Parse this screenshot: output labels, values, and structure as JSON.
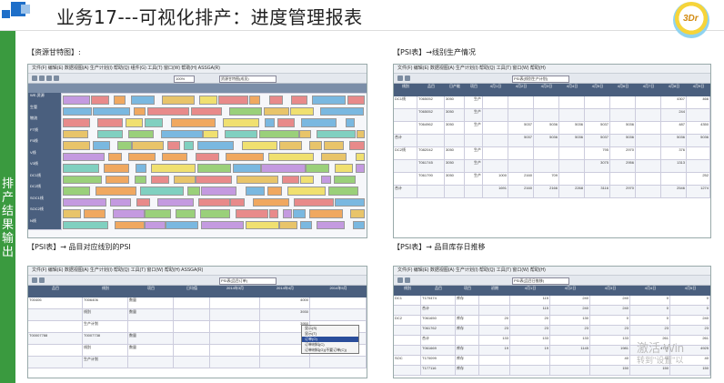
{
  "header": {
    "title": "业务17---可视化排产：进度管理报表",
    "side_text": "排产结果输出",
    "brand_text": "3Dr"
  },
  "sections": {
    "gantt_label": "【资源甘特图】:",
    "psi_line_label": "【PSI表】→线别生产情况",
    "psi_item_label": "【PSI表】→ 品目对应线别的PSI",
    "psi_stock_label": "【PSI表】→ 品目库存日推移"
  },
  "gantt": {
    "menu": "文件(F)  编辑(E)  数据视图(A)  生产计划(I)  帮助(Q)  组件(G)  工具(T)  窗口(W)  帮助(H)  ASSGA(R)",
    "zoom": "100%",
    "view": "资源甘特图(成员)",
    "rows": [
      "WE-资源",
      "生管",
      "物流",
      "FT线",
      "F5线",
      "V线",
      "V3线",
      "DC1线",
      "DC2线",
      "SOC1线",
      "SOC2线",
      "N线"
    ]
  },
  "psi_line": {
    "menu": "文件(F)  编辑(E)  数据视图(A)  生产计划(I)  帮助(Q)  工具(T)  窗口(W)  帮助(H)",
    "view": "PSI表(线别生产计划)",
    "headers": [
      "线别",
      "品目",
      "日产能",
      "项目",
      "4月1日",
      "4月2日",
      "4月3日",
      "4月4日",
      "4月5日",
      "4月6日",
      "4月7日",
      "4月8日",
      "4月9日"
    ],
    "rows": [
      [
        "DC1线",
        "T065052",
        "3050",
        "生产",
        "",
        "",
        "",
        "",
        "",
        "",
        "",
        "4307",
        "466"
      ],
      [
        "",
        "T065052",
        "3050",
        "生产",
        "",
        "",
        "",
        "",
        "",
        "",
        "",
        "244",
        ""
      ],
      [
        "",
        "T064962",
        "3050",
        "生产",
        "",
        "5037",
        "5036",
        "5036",
        "5037",
        "5036",
        "",
        "487",
        "4350"
      ],
      [
        "合计",
        "",
        "",
        "",
        "",
        "5037",
        "5036",
        "5036",
        "5037",
        "5036",
        "",
        "5036",
        "5036"
      ],
      [
        "DC2线",
        "T082042",
        "3050",
        "生产",
        "",
        "",
        "",
        "",
        "795",
        "2970",
        "",
        "376",
        ""
      ],
      [
        "",
        "T061745",
        "3050",
        "生产",
        "",
        "",
        "",
        "",
        "3075",
        "2956",
        "",
        "1313",
        ""
      ],
      [
        "",
        "T061790",
        "3050",
        "生产",
        "1000",
        "2160",
        "709",
        "",
        "",
        "",
        "",
        "",
        "252"
      ],
      [
        "合计",
        "",
        "",
        "",
        "1691",
        "2160",
        "2166",
        "2268",
        "3116",
        "2970",
        "",
        "2546",
        "1274"
      ]
    ]
  },
  "psi_item": {
    "menu": "文件(F)  编辑(E)  数据视图(A)  生产计划(I)  帮助(Q)  工具(T)  窗口(W)  帮助(H)  ASSGA(R)",
    "view": "PSI表(品目订单)",
    "headers": [
      "品目",
      "线别",
      "项目",
      "日均值",
      "2014年3月",
      "2014年4月",
      "2014年5月"
    ],
    "rows": [
      [
        "T00406",
        "T006406",
        "数量",
        "",
        "",
        "4000",
        ""
      ],
      [
        "",
        "线别",
        "数量",
        "",
        "",
        "3930",
        ""
      ],
      [
        "",
        "生产计划",
        "",
        "",
        "",
        "3950",
        ""
      ],
      [
        "T00007788",
        "T0007738",
        "数量",
        "",
        "",
        "",
        "",
        ""
      ],
      [
        "",
        "线别",
        "数量",
        "",
        "",
        "17",
        ""
      ],
      [
        "",
        "生产计划",
        "",
        "",
        "",
        "",
        ""
      ]
    ],
    "context_menu": [
      "显示(S)",
      "显示(T)",
      "订单(O)",
      "订单材料(C)",
      "订单材料(G)(不要订单(C))"
    ]
  },
  "psi_stock": {
    "menu": "文件(F)  编辑(E)  数据视图(A)  生产计划(I)  帮助(Q)  工具(T)  窗口(W)  帮助(H)",
    "view": "PSI表(品目日推移)",
    "headers": [
      "线别",
      "品目",
      "项目",
      "初期",
      "4月1日",
      "4月2日",
      "4月3日",
      "4月4日",
      "4月5日"
    ],
    "rows": [
      [
        "DC1",
        "T170474",
        "库存",
        "",
        "115",
        "240",
        "240",
        "0",
        "0"
      ],
      [
        "",
        "合计",
        "",
        "",
        "115",
        "240",
        "240",
        "0",
        "0"
      ],
      [
        "DC2",
        "T061650",
        "库存",
        "20",
        "20",
        "130",
        "0",
        "0",
        "240"
      ],
      [
        "",
        "T061762",
        "库存",
        "23",
        "23",
        "23",
        "23",
        "23",
        "23"
      ],
      [
        "",
        "合计",
        "",
        "133",
        "133",
        "133",
        "133",
        "261",
        "261"
      ],
      [
        "",
        "T061669",
        "库存",
        "19",
        "19",
        "1145",
        "1981",
        "4725",
        "4925"
      ],
      [
        "SOC",
        "T170099",
        "库存",
        "",
        "",
        "",
        "40",
        "40",
        "40"
      ],
      [
        "",
        "T177116",
        "库存",
        "",
        "",
        "",
        "150",
        "150",
        "150"
      ]
    ]
  },
  "watermark": {
    "line1": "激活 Win",
    "line2": "转到\"设置\"以"
  }
}
